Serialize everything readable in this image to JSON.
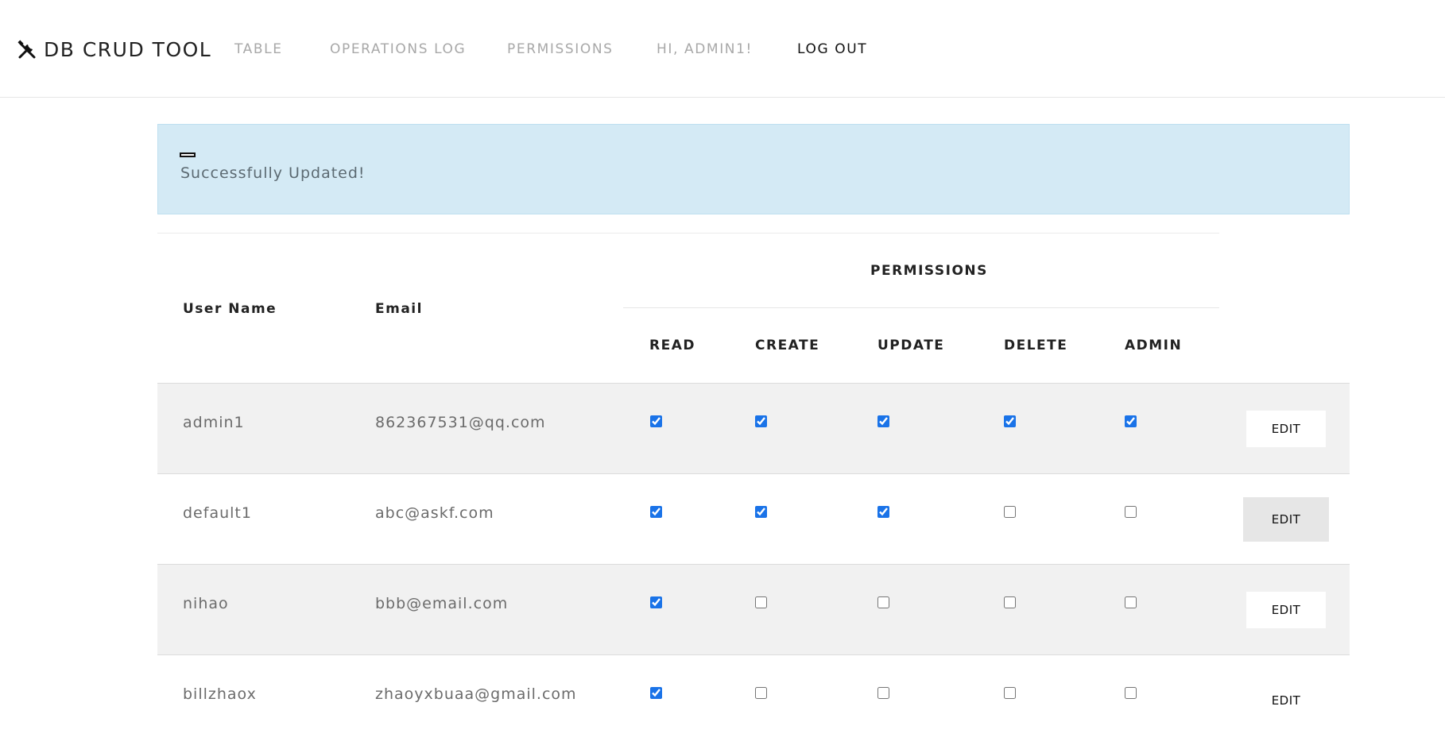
{
  "nav": {
    "brand": "DB CRUD TOOL",
    "brand_icon": "tools-icon",
    "items": [
      "TABLE",
      "OPERATIONS LOG",
      "PERMISSIONS",
      "HI, ADMIN1!",
      "LOG OUT"
    ]
  },
  "alert": {
    "message": "Successfully Updated!",
    "color": "#d4eaf5"
  },
  "table": {
    "headers": {
      "user_name": "User Name",
      "email": "Email",
      "permissions_group": "PERMISSIONS",
      "permissions": [
        "READ",
        "CREATE",
        "UPDATE",
        "DELETE",
        "ADMIN"
      ]
    },
    "rows": [
      {
        "user": "admin1",
        "email": "862367531@qq.com",
        "perms": [
          true,
          true,
          true,
          true,
          true
        ],
        "action": "EDIT"
      },
      {
        "user": "default1",
        "email": "abc@askf.com",
        "perms": [
          true,
          true,
          true,
          false,
          false
        ],
        "action": "EDIT"
      },
      {
        "user": "nihao",
        "email": "bbb@email.com",
        "perms": [
          true,
          false,
          false,
          false,
          false
        ],
        "action": "EDIT"
      },
      {
        "user": "billzhaox",
        "email": "zhaoyxbuaa@gmail.com",
        "perms": [
          true,
          false,
          false,
          false,
          false
        ],
        "action": "EDIT"
      }
    ]
  },
  "colors": {
    "checkbox_accent": "#1a73e8",
    "row_shade": "#f1f1f1"
  }
}
